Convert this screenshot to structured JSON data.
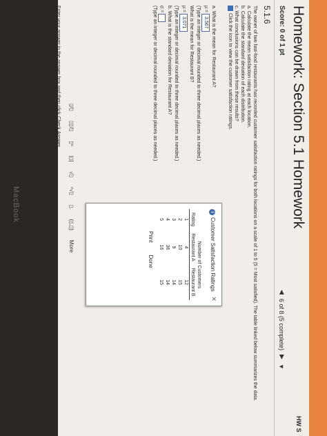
{
  "header": {
    "title": "Homework: Section 5.1 Homework",
    "right_text": "HW S",
    "score": "Score: 0 of 1 pt",
    "nav": {
      "prev": "◀",
      "status": "6 of 8 (5 complete)",
      "next": "▶",
      "menu": "▼"
    }
  },
  "question": {
    "number": "5.1.6",
    "lines": [
      "The owner of two fast-food restaurants has recorded customer satisfaction ratings for both locations on a scale of 1 to 5 (5 = Most satisfied). The table linked below summarizes the data.",
      "a. Calculate the mean satisfaction rating at each location.",
      "b. Calculate the standard deviation of each distribution.",
      "c. What conclusions can be drawn from these results?"
    ],
    "icon_line": "Click the icon to view the customer satisfaction ratings."
  },
  "work": {
    "a_label": "a. What is the mean for Restaurant A?",
    "mu_symbol": "μ =",
    "a_value": "3.567",
    "a_note": "(Type an integer or decimal rounded to three decimal places as needed.)",
    "b_question": "What is the mean for Restaurant B?",
    "b_value": "3.071",
    "b_note": "(Type an integer or decimal rounded to three decimal places as needed.)",
    "sd_question": "b. What is the standard deviation for Restaurant A?",
    "sigma_symbol": "σ =",
    "sd_note": "(Type an integer or decimal rounded to three decimal places as needed.)"
  },
  "popup": {
    "title": "Customer Satisfaction Ratings",
    "close": "✕",
    "group_header": "Number of Customers",
    "columns": [
      "Rating",
      "Restaurant A",
      "Restaurant B"
    ],
    "rows": [
      [
        "1",
        "4",
        "12"
      ],
      [
        "2",
        "10",
        "15"
      ],
      [
        "3",
        "9",
        "14"
      ],
      [
        "4",
        "36",
        "14"
      ],
      [
        "5",
        "16",
        "15"
      ]
    ],
    "print": "Print",
    "done": "Done"
  },
  "toolbar": {
    "tools": [
      "▯/▯",
      "▯▯/▯",
      "▯ⁿ",
      "|▯|",
      "√▯",
      "ⁿ√▯",
      "▯.",
      "(▯,▯)"
    ],
    "more": "More"
  },
  "footer": {
    "instruction": "Enter your answer in the answer box and then click Check Answer.",
    "parts_count": "2",
    "parts_label_1": "parts",
    "parts_label_2": "remaining",
    "clear_all": "Clear All",
    "progress_fraction": 0.35
  },
  "device": {
    "brand": "MacBook"
  }
}
